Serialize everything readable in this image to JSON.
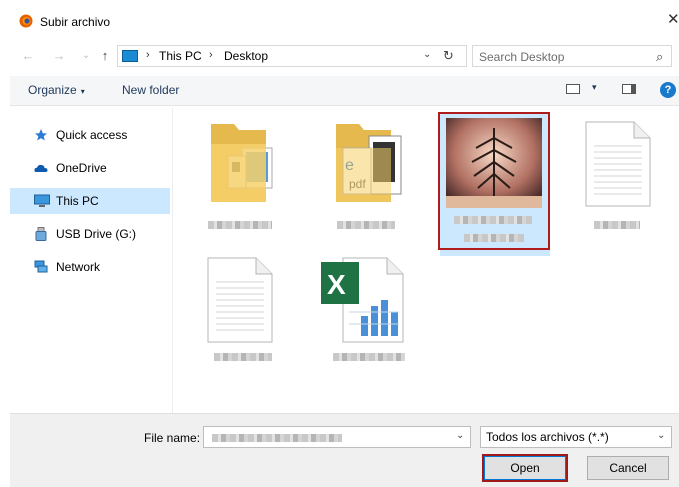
{
  "window": {
    "title": "Subir archivo",
    "close_glyph": "✕",
    "app_icon": "firefox-icon"
  },
  "navigation": {
    "back": "←",
    "forward": "→",
    "recent": "⌄",
    "up": "↑"
  },
  "address": {
    "crumbs": [
      "This PC",
      "Desktop"
    ],
    "separator": "›",
    "refresh": "↻",
    "dropdown": "⌄"
  },
  "search": {
    "placeholder": "Search Desktop",
    "icon": "⌕"
  },
  "commandbar": {
    "organize_label": "Organize",
    "organize_caret": "▾",
    "new_folder_label": "New folder",
    "help_label": "?"
  },
  "sidebar": {
    "items": [
      {
        "label": "Quick access",
        "icon": "star-icon"
      },
      {
        "label": "OneDrive",
        "icon": "cloud-icon"
      },
      {
        "label": "This PC",
        "icon": "computer-icon",
        "selected": true
      },
      {
        "label": "USB Drive (G:)",
        "icon": "usb-drive-icon"
      },
      {
        "label": "Network",
        "icon": "network-icon"
      }
    ]
  },
  "files": {
    "items": [
      {
        "type": "folder-with-documents",
        "icon": "folder-icon",
        "name_blurred": true
      },
      {
        "type": "folder-with-pdf",
        "icon": "folder-icon",
        "name_blurred": true
      },
      {
        "type": "image-thumbnail",
        "icon": "image-thumbnail",
        "name_blurred": true,
        "selected": true
      },
      {
        "type": "text-document",
        "icon": "document-icon",
        "name_blurred": true
      },
      {
        "type": "text-document",
        "icon": "document-icon",
        "name_blurred": true
      },
      {
        "type": "excel-spreadsheet",
        "icon": "excel-icon",
        "name_blurred": true
      }
    ]
  },
  "footer": {
    "filename_label": "File name:",
    "filename_value_blurred": true,
    "filetype_value": "Todos los archivos (*.*)",
    "open_label": "Open",
    "cancel_label": "Cancel",
    "dropdown": "⌄"
  },
  "colors": {
    "selection": "#cce8ff",
    "highlight_border": "#b01c1c",
    "accent": "#0078d7"
  }
}
